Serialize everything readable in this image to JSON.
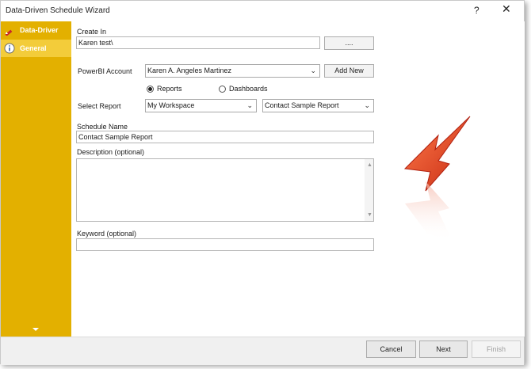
{
  "window": {
    "title": "Data-Driven Schedule Wizard",
    "help": "?",
    "close": "✕"
  },
  "sidebar": {
    "items": [
      {
        "label": "Data-Driver",
        "icon": "pencil-icon",
        "active": false
      },
      {
        "label": "General",
        "icon": "info-icon",
        "active": true
      }
    ]
  },
  "form": {
    "create_in_label": "Create In",
    "create_in_value": "Karen test\\",
    "browse_label": "....",
    "account_label": "PowerBI Account",
    "account_value": "Karen A. Angeles Martinez",
    "add_new_label": "Add New",
    "radio_reports": "Reports",
    "radio_dashboards": "Dashboards",
    "select_report_label": "Select Report",
    "workspace_value": "My Workspace",
    "report_value": "Contact Sample Report",
    "schedule_name_label": "Schedule Name",
    "schedule_name_value": "Contact Sample Report",
    "description_label": "Description (optional)",
    "description_value": "",
    "keyword_label": "Keyword (optional)",
    "keyword_value": ""
  },
  "footer": {
    "cancel": "Cancel",
    "next": "Next",
    "finish": "Finish"
  },
  "colors": {
    "sidebar": "#e3b000",
    "sidebar_active": "#f3cc3a",
    "accent_arrow": "#e8452a"
  }
}
